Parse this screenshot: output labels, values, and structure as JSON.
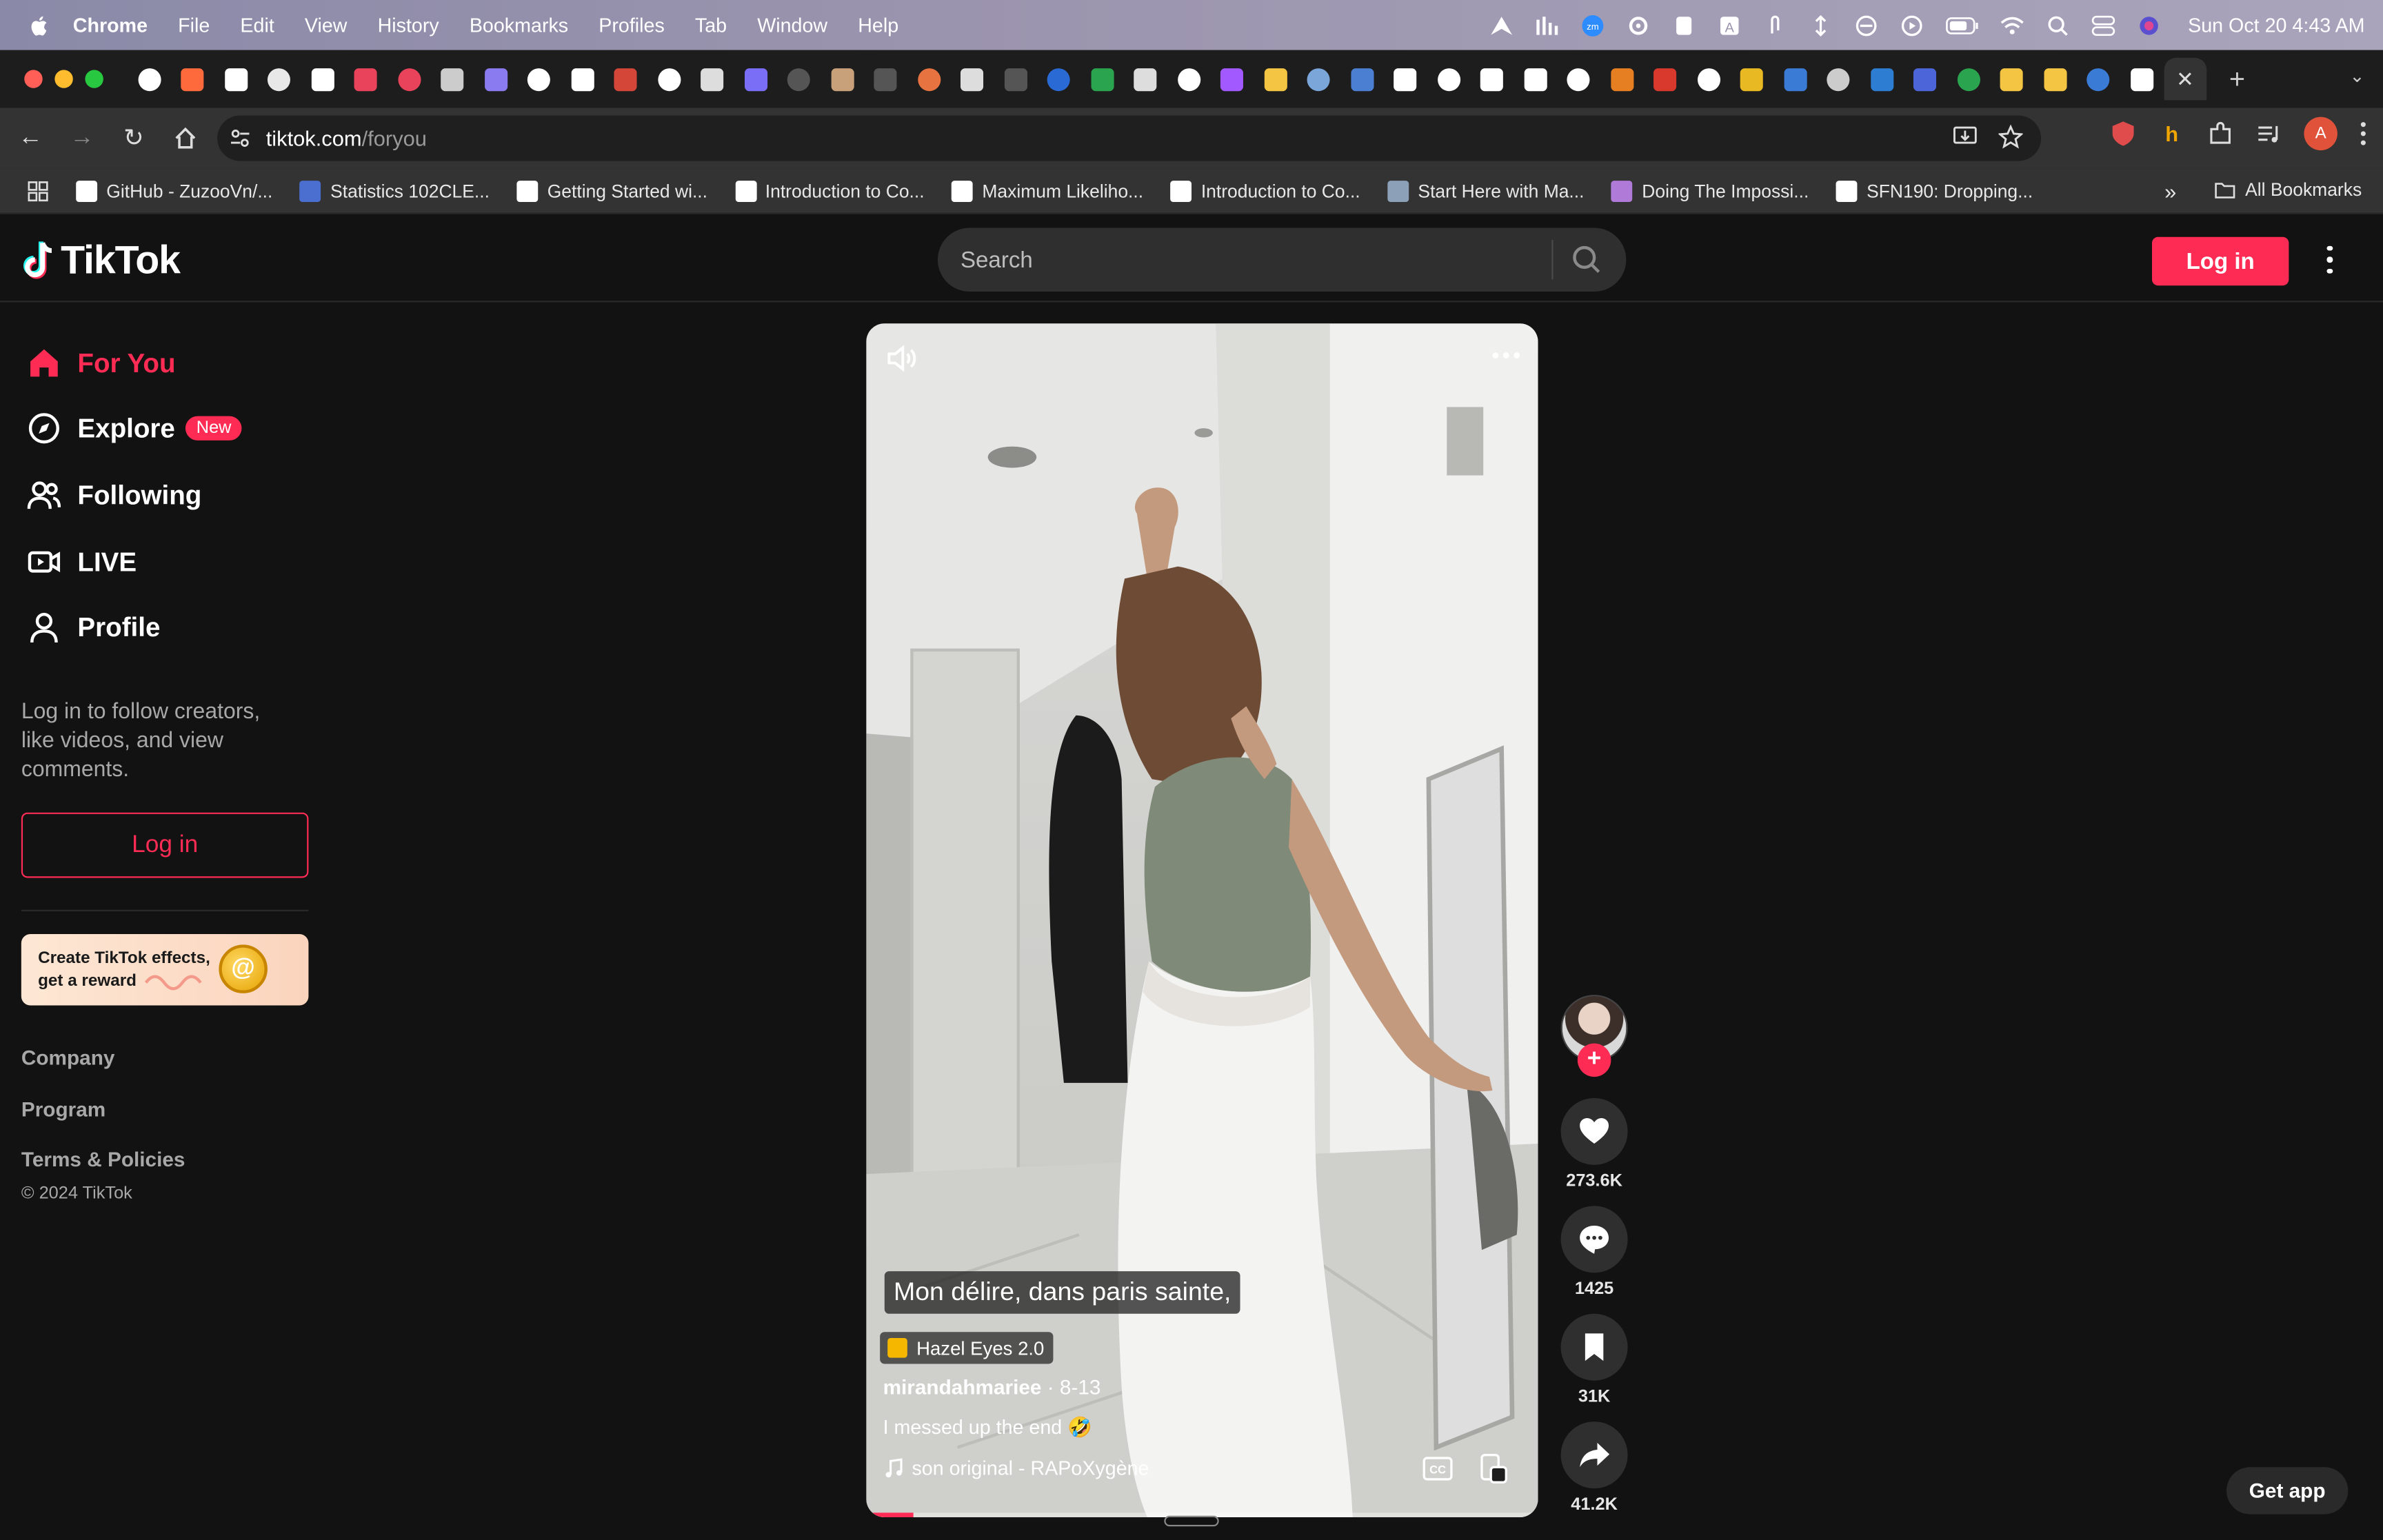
{
  "menubar": {
    "app": "Chrome",
    "items": [
      "File",
      "Edit",
      "View",
      "History",
      "Bookmarks",
      "Profiles",
      "Tab",
      "Window",
      "Help"
    ],
    "clock": "Sun Oct 20  4:43 AM"
  },
  "toolbar": {
    "url_host": "tiktok.com",
    "url_path": "/foryou",
    "profile_initial": "A"
  },
  "bookmarks": {
    "items": [
      {
        "label": "GitHub - ZuzooVn/...",
        "color": "#ffffff"
      },
      {
        "label": "Statistics 102CLE...",
        "color": "#4a6fd1"
      },
      {
        "label": "Getting Started wi...",
        "color": "#ffffff"
      },
      {
        "label": "Introduction to Co...",
        "color": "#ffffff"
      },
      {
        "label": "Maximum Likeliho...",
        "color": "#ffffff"
      },
      {
        "label": "Introduction to Co...",
        "color": "#ffffff"
      },
      {
        "label": "Start Here with Ma...",
        "color": "#8ca0b8"
      },
      {
        "label": "Doing The Impossi...",
        "color": "#b07ad9"
      },
      {
        "label": "SFN190: Dropping...",
        "color": "#ffffff"
      }
    ],
    "more": "»",
    "all": "All Bookmarks"
  },
  "tiktok": {
    "logo": "TikTok",
    "search_placeholder": "Search",
    "header_login": "Log in",
    "nav": {
      "for_you": "For You",
      "explore": "Explore",
      "explore_badge": "New",
      "following": "Following",
      "live": "LIVE",
      "profile": "Profile"
    },
    "login_hint": "Log in to follow creators, like videos, and view comments.",
    "sidebar_login": "Log in",
    "effects_promo": {
      "line1": "Create TikTok effects,",
      "line2": "get a reward"
    },
    "footer": {
      "company": "Company",
      "program": "Program",
      "terms": "Terms & Policies",
      "copyright": "© 2024 TikTok"
    },
    "get_app": "Get app"
  },
  "video": {
    "caption": "Mon délire, dans paris sainte,",
    "effect": "Hazel Eyes 2.0",
    "author": "mirandahmariee",
    "date": " · 8-13",
    "description": "I messed up the end 🤣",
    "sound": "son original - RAPoXygène",
    "progress": 0.07,
    "likes": "273.6K",
    "comments": "1425",
    "saves": "31K",
    "shares": "41.2K"
  },
  "colors": {
    "accent": "#fe2c55",
    "background": "#121212"
  }
}
